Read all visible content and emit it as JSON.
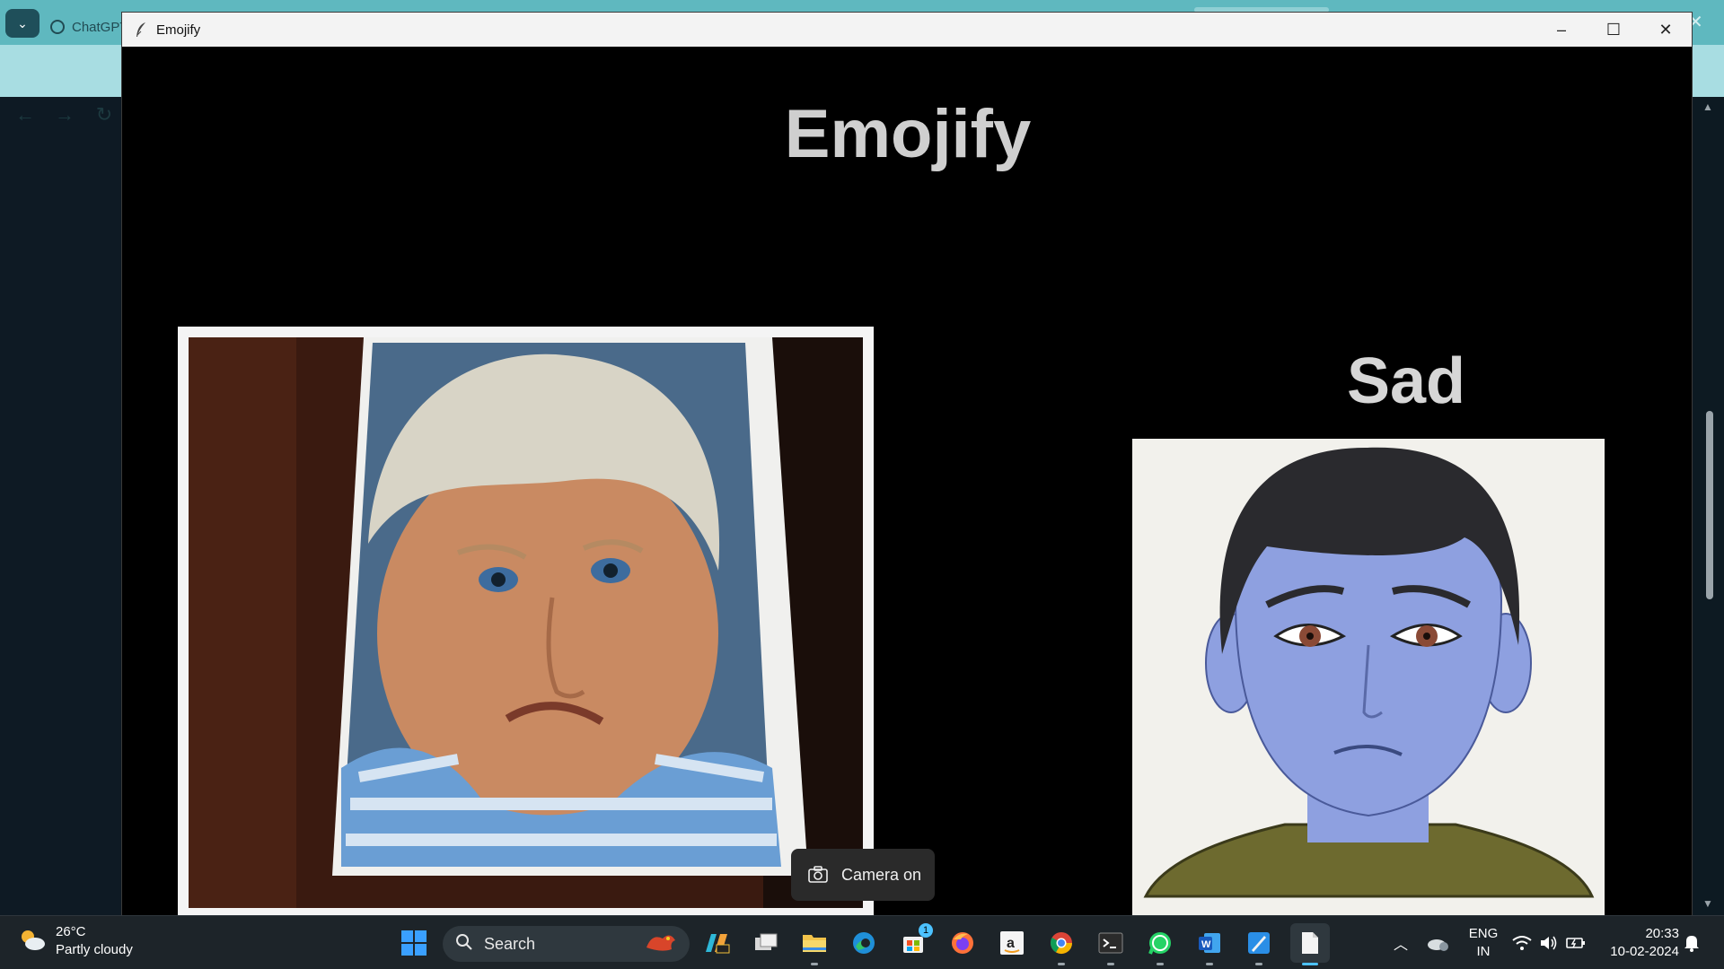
{
  "browser": {
    "background_tab_label": "ChatGPT"
  },
  "window": {
    "title": "Emojify",
    "controls": {
      "minimize": "–",
      "maximize": "☐",
      "close": "✕"
    }
  },
  "app": {
    "heading": "Emojify",
    "emotion_label": "Sad",
    "camera_toast": "Camera on"
  },
  "taskbar": {
    "weather": {
      "temperature": "26°C",
      "condition": "Partly cloudy"
    },
    "search_placeholder": "Search",
    "store_badge": "1",
    "language": {
      "line1": "ENG",
      "line2": "IN"
    },
    "clock": {
      "time": "20:33",
      "date": "10-02-2024"
    }
  }
}
